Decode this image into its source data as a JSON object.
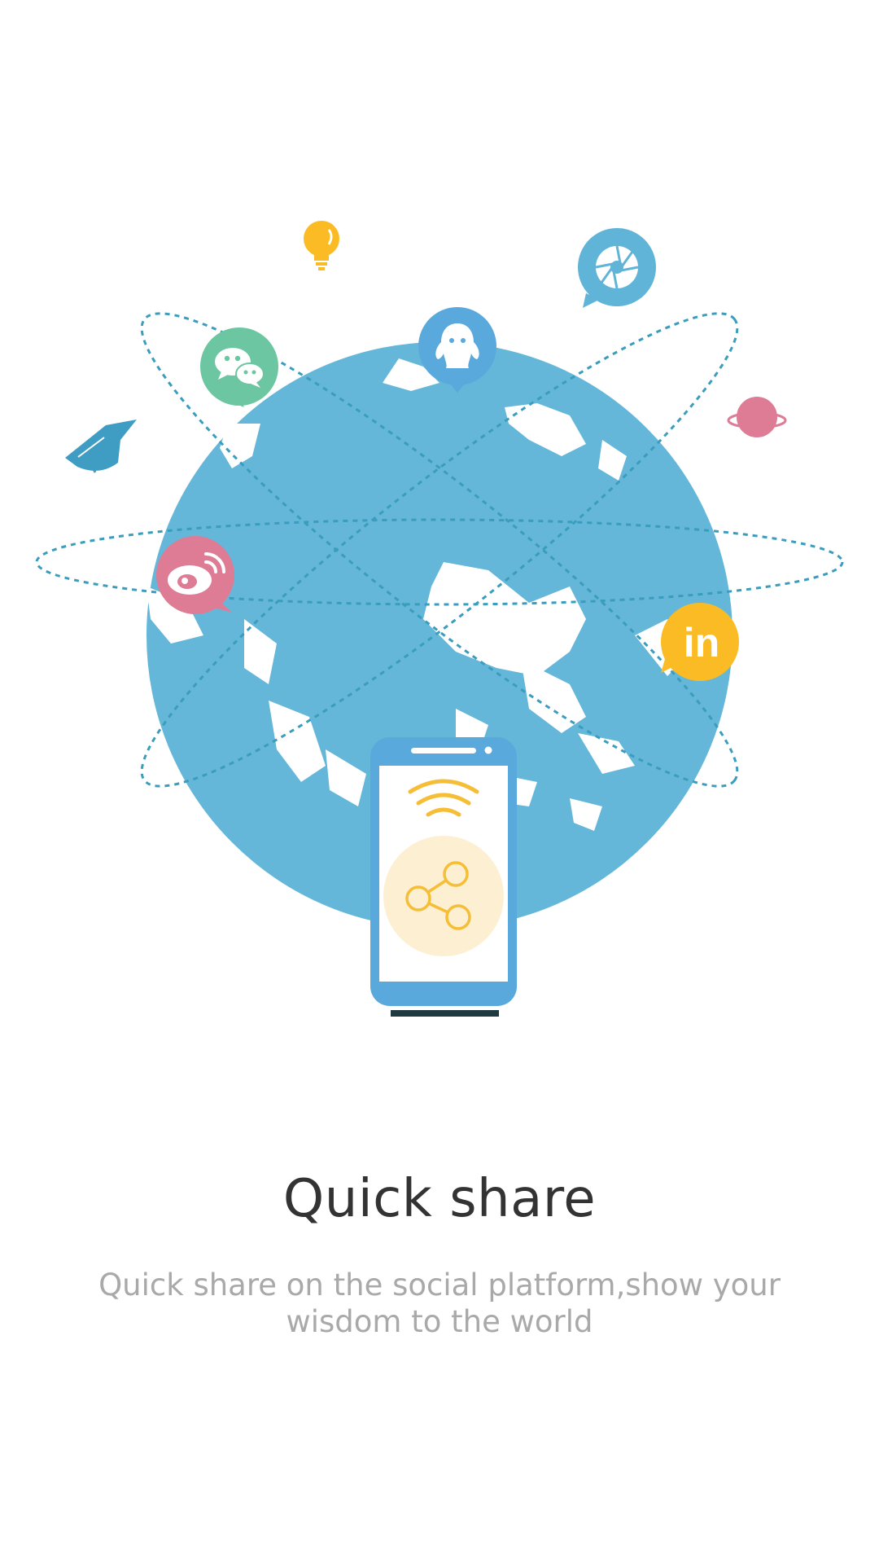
{
  "onboarding": {
    "title": "Quick share",
    "subtitle": "Quick share on the social platform,show your wisdom to the world"
  },
  "illustration": {
    "platform_icons": [
      "wechat-icon",
      "qq-icon",
      "camera-shutter-icon",
      "weibo-icon",
      "linkedin-icon"
    ],
    "linkedin_label": "in",
    "decorations": [
      "lightbulb-icon",
      "graduation-cap-icon",
      "planet-icon"
    ],
    "colors": {
      "globe": "#64b7d8",
      "orbit": "#3a9dbd",
      "phone": "#5aa9dc",
      "wechat": "#6cc6a1",
      "qq": "#5aa9dc",
      "camera": "#5fb4d8",
      "weibo": "#de7c96",
      "linkedin": "#fbbb24",
      "bulb": "#fbbb24",
      "planet": "#de7c96",
      "cap": "#3f9cc3",
      "share_circle": "#fdf0d2",
      "share_stroke": "#f6be36",
      "title": "#333333",
      "subtitle": "#a9a9a9"
    }
  }
}
